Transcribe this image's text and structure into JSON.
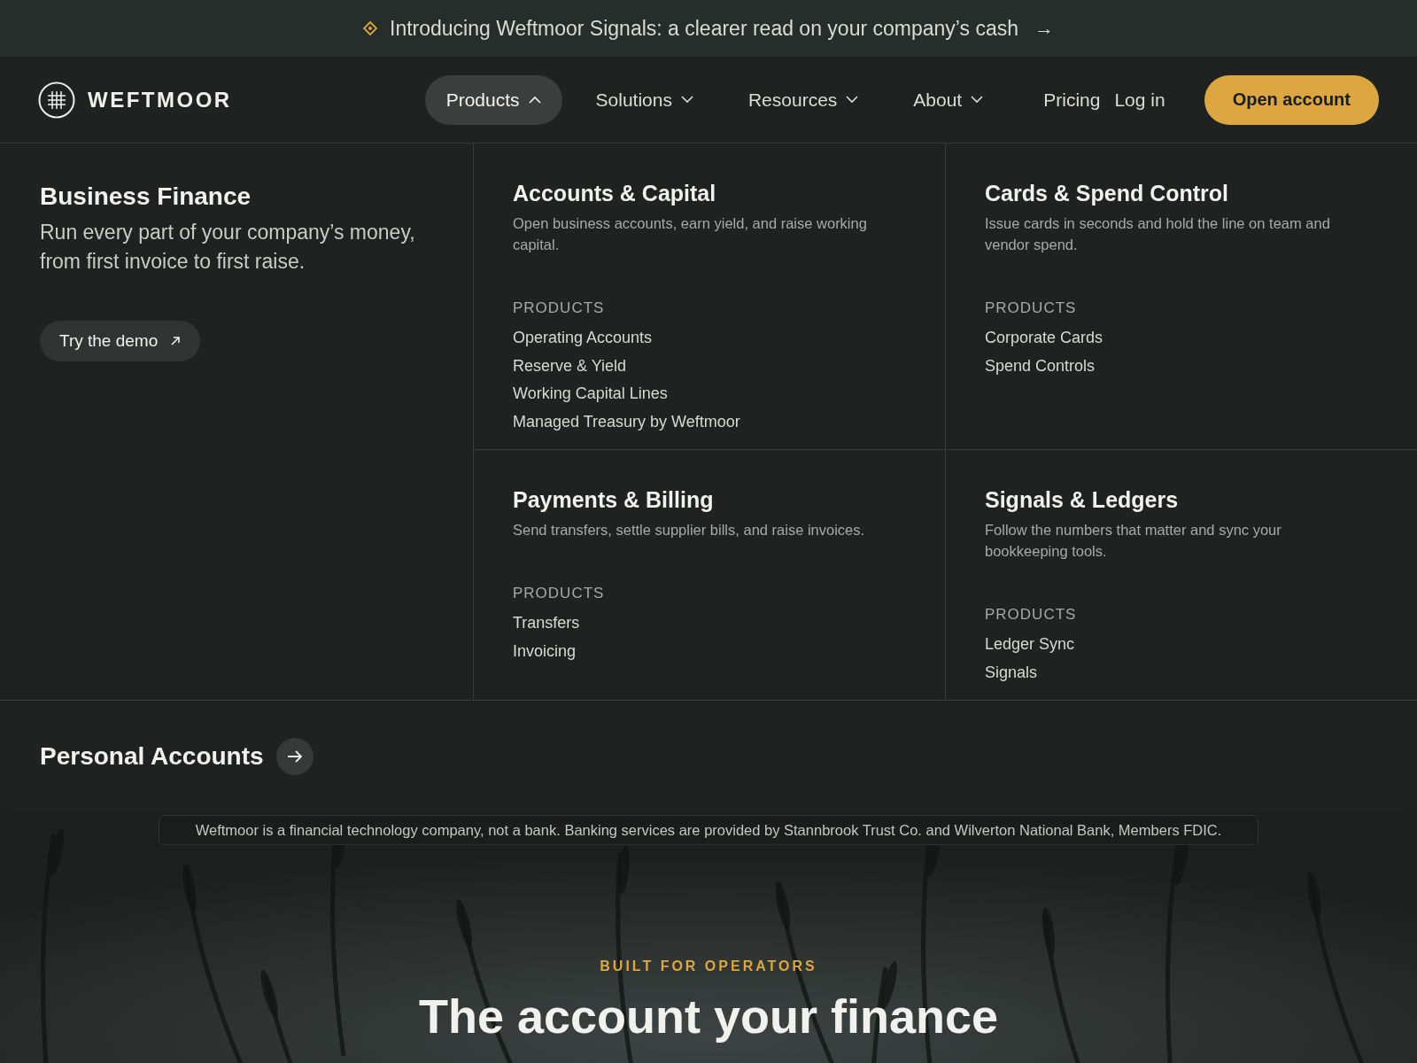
{
  "announcement": {
    "text": "Introducing Weftmoor Signals: a clearer read on your company’s cash",
    "arrow": "→"
  },
  "brand": {
    "name": "WEFTMOOR"
  },
  "nav": {
    "items": [
      {
        "label": "Products",
        "kind": "dropdown",
        "expanded": true
      },
      {
        "label": "Solutions",
        "kind": "dropdown",
        "expanded": false
      },
      {
        "label": "Resources",
        "kind": "dropdown",
        "expanded": false
      },
      {
        "label": "About",
        "kind": "dropdown",
        "expanded": false
      },
      {
        "label": "Pricing",
        "kind": "link"
      },
      {
        "label": "Log in",
        "kind": "link"
      }
    ],
    "cta": "Open account"
  },
  "menu": {
    "intro": {
      "title": "Business Finance",
      "description": "Run every part of your company’s money, from first invoice to first raise.",
      "button": "Try the demo"
    },
    "groups": [
      {
        "title": "Accounts & Capital",
        "description": "Open business accounts, earn yield, and raise working capital.",
        "section_label": "PRODUCTS",
        "links": [
          "Operating Accounts",
          "Reserve & Yield",
          "Working Capital Lines",
          "Managed Treasury by Weftmoor"
        ]
      },
      {
        "title": "Cards & Spend Control",
        "description": "Issue cards in seconds and hold the line on team and vendor spend.",
        "section_label": "PRODUCTS",
        "links": [
          "Corporate Cards",
          "Spend Controls"
        ]
      },
      {
        "title": "Payments & Billing",
        "description": "Send transfers, settle supplier bills, and raise invoices.",
        "section_label": "PRODUCTS",
        "links": [
          "Transfers",
          "Invoicing"
        ]
      },
      {
        "title": "Signals & Ledgers",
        "description": "Follow the numbers that matter and sync your bookkeeping tools.",
        "section_label": "PRODUCTS",
        "links": [
          "Ledger Sync",
          "Signals"
        ]
      }
    ],
    "footer": {
      "label": "Personal Accounts"
    }
  },
  "disclaimer": "Weftmoor is a financial technology company, not a bank. Banking services are provided by Stannbrook Trust Co. and Wilverton National Bank, Members FDIC.",
  "hero": {
    "eyebrow": "BUILT FOR OPERATORS",
    "headline": "The account your finance"
  }
}
